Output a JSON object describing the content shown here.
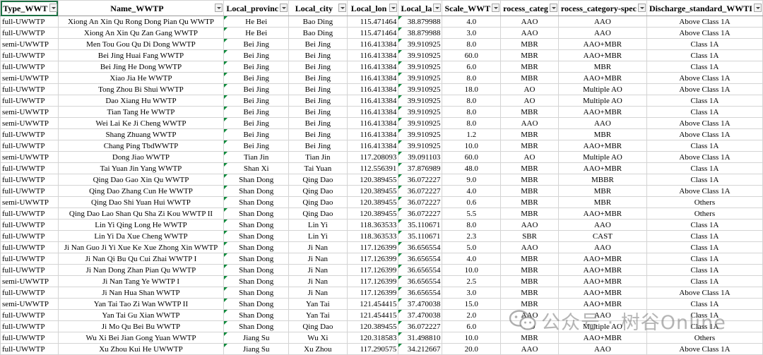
{
  "columns": [
    "Type_WWT",
    "Name_WWTP",
    "Local_provinc",
    "Local_city",
    "Local_lon",
    "Local_la",
    "Scale_WWT",
    "rocess_categ",
    "rocess_category-spec",
    "Discharge_standard_WWTI"
  ],
  "rows": [
    [
      "full-UWWTP",
      "Xiong An Xin Qu Rong Dong Pian Qu WWTP",
      "He Bei",
      "Bao Ding",
      "115.471464",
      "38.879988",
      "4.0",
      "AAO",
      "AAO",
      "Above Class 1A"
    ],
    [
      "full-UWWTP",
      "Xiong An Xin Qu Zan Gang WWTP",
      "He Bei",
      "Bao Ding",
      "115.471464",
      "38.879988",
      "3.0",
      "AAO",
      "AAO",
      "Above Class 1A"
    ],
    [
      "semi-UWWTP",
      "Men Tou Gou Qu Di Dong WWTP",
      "Bei Jing",
      "Bei Jing",
      "116.413384",
      "39.910925",
      "8.0",
      "MBR",
      "AAO+MBR",
      "Class 1A"
    ],
    [
      "full-UWWTP",
      "Bei Jing Huai Fang WWTP",
      "Bei Jing",
      "Bei Jing",
      "116.413384",
      "39.910925",
      "60.0",
      "MBR",
      "AAO+MBR",
      "Class 1A"
    ],
    [
      "full-UWWTP",
      "Bei Jing He Dong WWTP",
      "Bei Jing",
      "Bei Jing",
      "116.413384",
      "39.910925",
      "6.0",
      "MBR",
      "MBR",
      "Class 1A"
    ],
    [
      "semi-UWWTP",
      "Xiao Jia He WWTP",
      "Bei Jing",
      "Bei Jing",
      "116.413384",
      "39.910925",
      "8.0",
      "MBR",
      "AAO+MBR",
      "Above Class 1A"
    ],
    [
      "full-UWWTP",
      "Tong Zhou Bi Shui WWTP",
      "Bei Jing",
      "Bei Jing",
      "116.413384",
      "39.910925",
      "18.0",
      "AO",
      "Multiple AO",
      "Above Class 1A"
    ],
    [
      "full-UWWTP",
      "Dao Xiang Hu WWTP",
      "Bei Jing",
      "Bei Jing",
      "116.413384",
      "39.910925",
      "8.0",
      "AO",
      "Multiple AO",
      "Class 1A"
    ],
    [
      "semi-UWWTP",
      "Tian Tang He WWTP",
      "Bei Jing",
      "Bei Jing",
      "116.413384",
      "39.910925",
      "8.0",
      "MBR",
      "AAO+MBR",
      "Class 1A"
    ],
    [
      "semi-UWWTP",
      "Wei Lai Ke Ji Cheng WWTP",
      "Bei Jing",
      "Bei Jing",
      "116.413384",
      "39.910925",
      "8.0",
      "AAO",
      "AAO",
      "Above Class 1A"
    ],
    [
      "full-UWWTP",
      "Shang Zhuang WWTP",
      "Bei Jing",
      "Bei Jing",
      "116.413384",
      "39.910925",
      "1.2",
      "MBR",
      "MBR",
      "Above Class 1A"
    ],
    [
      "full-UWWTP",
      "Chang Ping TbdWWTP",
      "Bei Jing",
      "Bei Jing",
      "116.413384",
      "39.910925",
      "10.0",
      "MBR",
      "AAO+MBR",
      "Class 1A"
    ],
    [
      "semi-UWWTP",
      "Dong Jiao WWTP",
      "Tian Jin",
      "Tian Jin",
      "117.208093",
      "39.091103",
      "60.0",
      "AO",
      "Multiple AO",
      "Above Class 1A"
    ],
    [
      "full-UWWTP",
      "Tai Yuan Jin Yang WWTP",
      "Shan Xi",
      "Tai Yuan",
      "112.556391",
      "37.876989",
      "48.0",
      "MBR",
      "AAO+MBR",
      "Class 1A"
    ],
    [
      "full-UWWTP",
      "Qing Dao Gao Xin Qu WWTP",
      "Shan Dong",
      "Qing Dao",
      "120.389455",
      "36.072227",
      "9.0",
      "MBR",
      "MBBR",
      "Class 1A"
    ],
    [
      "full-UWWTP",
      "Qing Dao Zhang Cun He WWTP",
      "Shan Dong",
      "Qing Dao",
      "120.389455",
      "36.072227",
      "4.0",
      "MBR",
      "MBR",
      "Above Class 1A"
    ],
    [
      "semi-UWWTP",
      "Qing Dao Shi Yuan Hui WWTP",
      "Shan Dong",
      "Qing Dao",
      "120.389455",
      "36.072227",
      "0.6",
      "MBR",
      "MBR",
      "Others"
    ],
    [
      "full-UWWTP",
      "Qing Dao Lao Shan Qu Sha Zi Kou WWTP II",
      "Shan Dong",
      "Qing Dao",
      "120.389455",
      "36.072227",
      "5.5",
      "MBR",
      "AAO+MBR",
      "Others"
    ],
    [
      "full-UWWTP",
      "Lin Yi Qing Long He WWTP",
      "Shan Dong",
      "Lin Yi",
      "118.363533",
      "35.110671",
      "8.0",
      "AAO",
      "AAO",
      "Class 1A"
    ],
    [
      "full-UWWTP",
      "Lin Yi Da Xue Cheng WWTP",
      "Shan Dong",
      "Lin Yi",
      "118.363533",
      "35.110671",
      "2.3",
      "SBR",
      "CAST",
      "Class 1A"
    ],
    [
      "full-UWWTP",
      "Ji Nan Guo Ji Yi Xue Ke Xue Zhong Xin WWTP",
      "Shan Dong",
      "Ji Nan",
      "117.126399",
      "36.656554",
      "5.0",
      "AAO",
      "AAO",
      "Class 1A"
    ],
    [
      "full-UWWTP",
      "Ji Nan Qi Bu Qu Cui Zhai WWTP I",
      "Shan Dong",
      "Ji Nan",
      "117.126399",
      "36.656554",
      "4.0",
      "MBR",
      "AAO+MBR",
      "Class 1A"
    ],
    [
      "full-UWWTP",
      "Ji Nan Dong Zhan Pian Qu WWTP",
      "Shan Dong",
      "Ji Nan",
      "117.126399",
      "36.656554",
      "10.0",
      "MBR",
      "AAO+MBR",
      "Class 1A"
    ],
    [
      "semi-UWWTP",
      "Ji Nan Tang Ye WWTP I",
      "Shan Dong",
      "Ji Nan",
      "117.126399",
      "36.656554",
      "2.5",
      "MBR",
      "AAO+MBR",
      "Class 1A"
    ],
    [
      "full-UWWTP",
      "Ji Nan Hua Shan WWTP",
      "Shan Dong",
      "Ji Nan",
      "117.126399",
      "36.656554",
      "3.0",
      "MBR",
      "AAO+MBR",
      "Above Class 1A"
    ],
    [
      "semi-UWWTP",
      "Yan Tai Tao Zi Wan WWTP II",
      "Shan Dong",
      "Yan Tai",
      "121.454415",
      "37.470038",
      "15.0",
      "MBR",
      "AAO+MBR",
      "Class 1A"
    ],
    [
      "full-UWWTP",
      "Yan Tai Gu Xian WWTP",
      "Shan Dong",
      "Yan Tai",
      "121.454415",
      "37.470038",
      "2.0",
      "AAO",
      "AAO",
      "Class 1A"
    ],
    [
      "full-UWWTP",
      "Ji Mo Qu Bei Bu WWTP",
      "Shan Dong",
      "Qing Dao",
      "120.389455",
      "36.072227",
      "6.0",
      "AO",
      "Multiple AO",
      "Class 1A"
    ],
    [
      "full-UWWTP",
      "Wu Xi Bei Jian Gong Yuan WWTP",
      "Jiang Su",
      "Wu Xi",
      "120.318583",
      "31.498810",
      "10.0",
      "MBR",
      "AAO+MBR",
      "Others"
    ],
    [
      "full-UWWTP",
      "Xu Zhou Kui He UWWTP",
      "Jiang Su",
      "Xu Zhou",
      "117.290575",
      "34.212667",
      "20.0",
      "AAO",
      "AAO",
      "Above Class 1A"
    ]
  ],
  "watermark": {
    "text": "公众号 · 树谷Online",
    "icon": "wechat-icon"
  }
}
